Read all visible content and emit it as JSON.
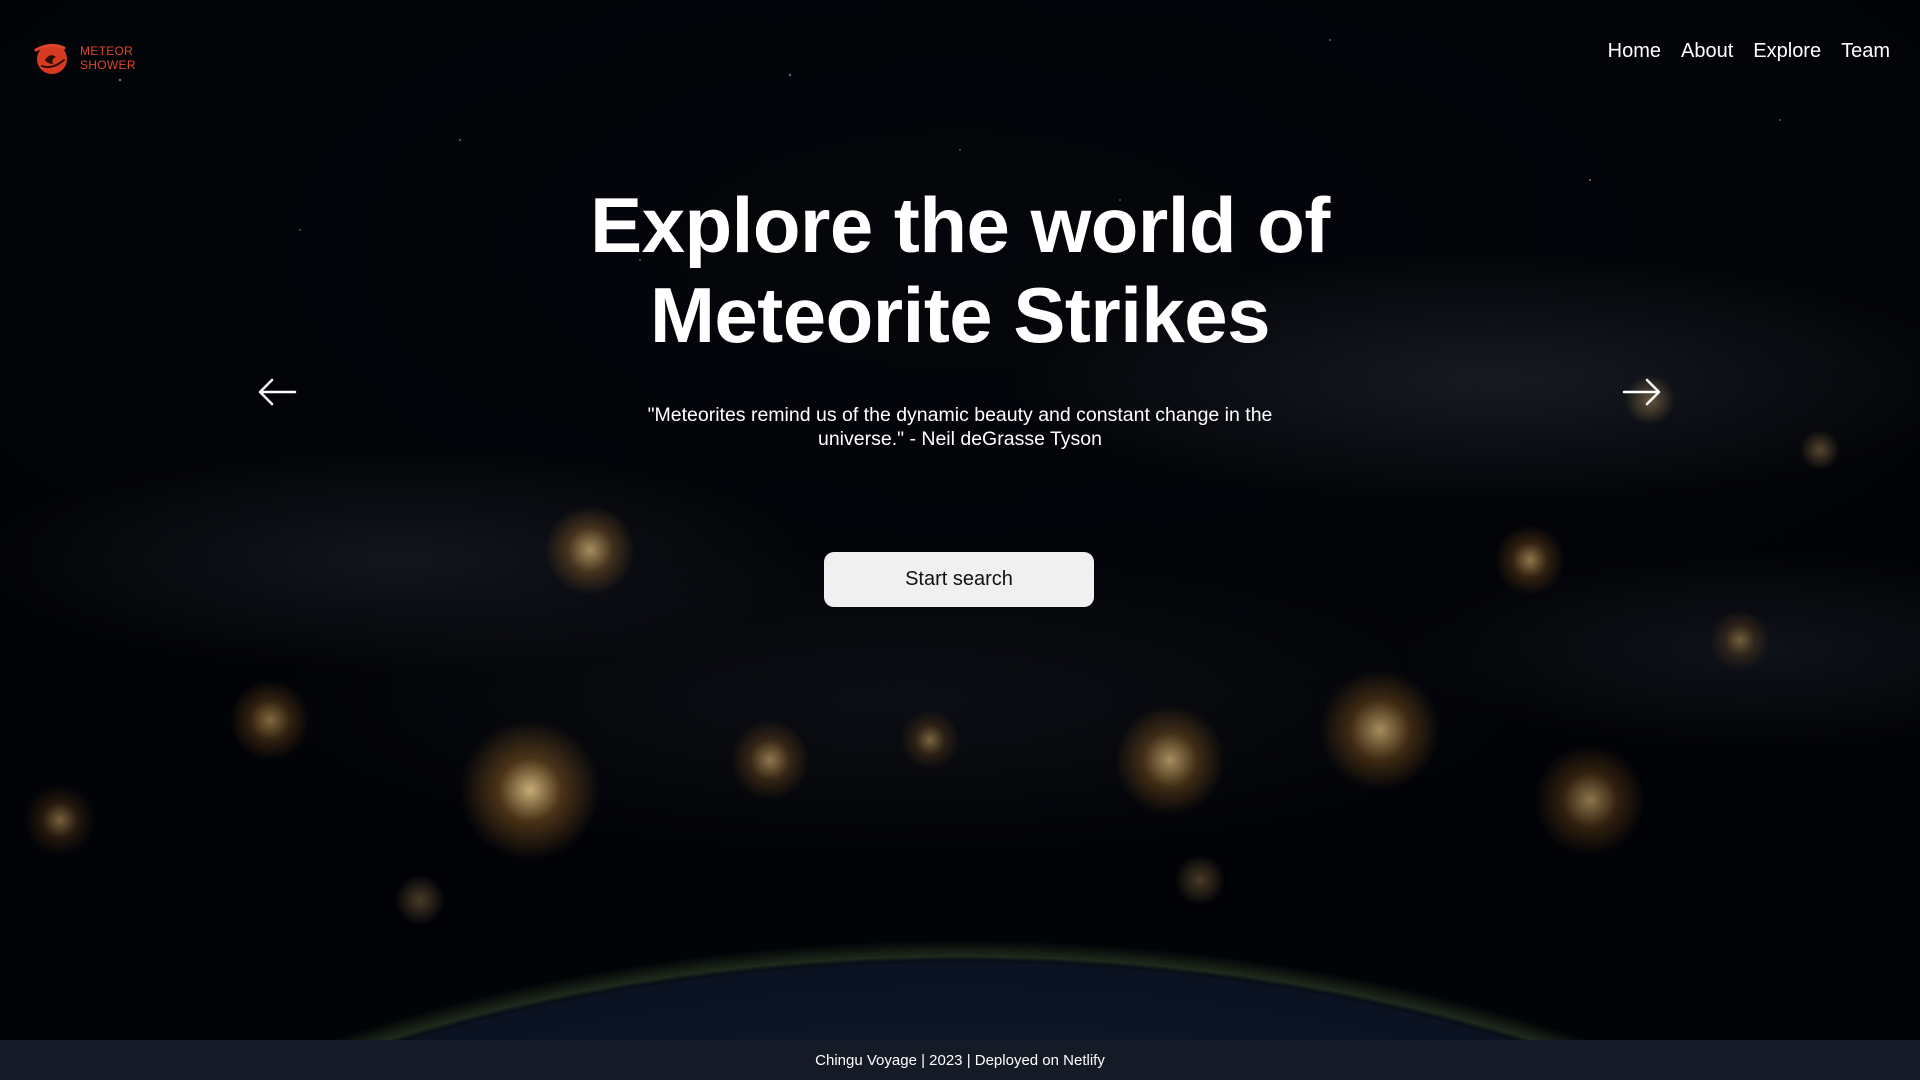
{
  "brand": {
    "line1": "METEOR",
    "line2": "SHOWER",
    "logo_icon": "meteor-logo-icon",
    "accent_color": "#e0452b"
  },
  "nav": {
    "items": [
      {
        "label": "Home"
      },
      {
        "label": "About"
      },
      {
        "label": "Explore"
      },
      {
        "label": "Team"
      }
    ]
  },
  "hero": {
    "title_line1": "Explore the world of",
    "title_line2": "Meteorite Strikes",
    "quote": "\"Meteorites remind us of the dynamic beauty and constant change in the universe.\" - Neil deGrasse Tyson",
    "cta_label": "Start search",
    "prev_icon": "arrow-left-icon",
    "next_icon": "arrow-right-icon"
  },
  "footer": {
    "text": "Chingu Voyage | 2023 | Deployed on Netlify"
  }
}
